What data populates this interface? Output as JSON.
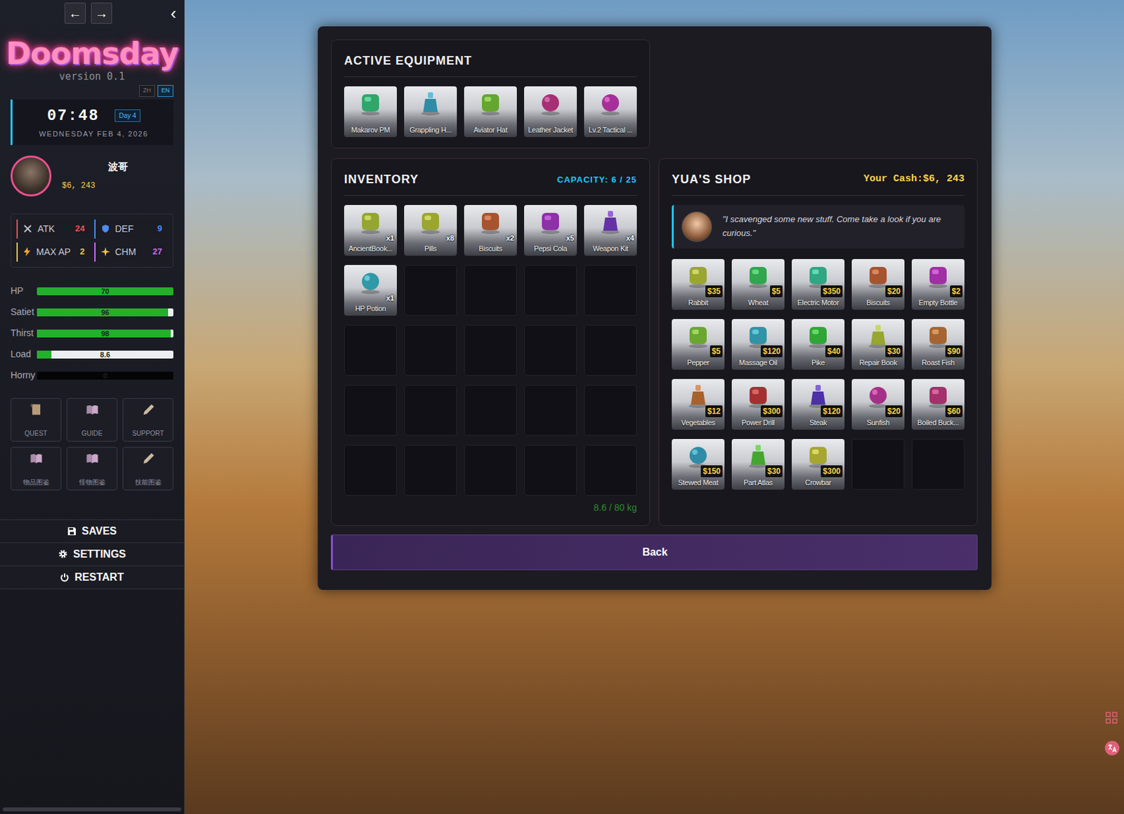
{
  "nav": {
    "back": "←",
    "forward": "→",
    "collapse": "‹"
  },
  "logo": {
    "title": "Doomsday",
    "version": "version 0.1"
  },
  "languages": [
    {
      "label": "ZH",
      "selected": false
    },
    {
      "label": "EN",
      "selected": true
    }
  ],
  "clock": {
    "time": "07:48",
    "day": "Day 4",
    "date": "WEDNESDAY FEB 4, 2026"
  },
  "player": {
    "name": "波哥",
    "cash": "$6, 243"
  },
  "stats": [
    {
      "label": "ATK",
      "value": "24",
      "color": "#ef5350"
    },
    {
      "label": "DEF",
      "value": "9",
      "color": "#4a8cf0"
    },
    {
      "label": "MAX AP",
      "value": "2",
      "color": "#f5c542"
    },
    {
      "label": "CHM",
      "value": "27",
      "color": "#c86cf0"
    }
  ],
  "meters": [
    {
      "label": "HP",
      "reading": "70",
      "level": 1,
      "kind": "light"
    },
    {
      "label": "Satiet",
      "reading": "96",
      "level": 0.96,
      "kind": "light"
    },
    {
      "label": "Thirst",
      "reading": "98",
      "level": 0.98,
      "kind": "light"
    },
    {
      "label": "Load",
      "reading": "8.6",
      "level": 0.1075,
      "kind": "light"
    },
    {
      "label": "Horny",
      "reading": "0",
      "level": 0,
      "kind": "dark"
    }
  ],
  "menu": [
    {
      "label": "QUEST"
    },
    {
      "label": "GUIDE"
    },
    {
      "label": "SUPPORT"
    },
    {
      "label": "物品图鉴"
    },
    {
      "label": "怪物图鉴"
    },
    {
      "label": "技能图鉴"
    }
  ],
  "system": [
    {
      "label": "SAVES"
    },
    {
      "label": "SETTINGS"
    },
    {
      "label": "RESTART"
    }
  ],
  "equipment": {
    "title": "ACTIVE EQUIPMENT",
    "items": [
      {
        "name": "Makarov PM"
      },
      {
        "name": "Grappling H..."
      },
      {
        "name": "Aviator Hat"
      },
      {
        "name": "Leather Jacket"
      },
      {
        "name": "Lv.2 Tactical ..."
      }
    ]
  },
  "inventory": {
    "title": "INVENTORY",
    "capacity": "CAPACITY: 6 / 25",
    "items": [
      {
        "name": "AncientBook...",
        "count": "x1"
      },
      {
        "name": "Pills",
        "count": "x8"
      },
      {
        "name": "Biscuits",
        "count": "x2"
      },
      {
        "name": "Pepsi Cola",
        "count": "x5"
      },
      {
        "name": "Weapon Kit",
        "count": "x4"
      },
      {
        "name": "HP Potion",
        "count": "x1"
      }
    ],
    "empty_slots": 19,
    "weight": "8.6 / 80 kg"
  },
  "shop": {
    "title": "YUA'S SHOP",
    "cash_label": "Your Cash:",
    "cash": "$6, 243",
    "quote": "\"I scavenged some new stuff. Come take a look if you are curious.\"",
    "items": [
      {
        "name": "Rabbit",
        "price": "$35"
      },
      {
        "name": "Wheat",
        "price": "$5"
      },
      {
        "name": "Electric Motor",
        "price": "$350"
      },
      {
        "name": "Biscuits",
        "price": "$20"
      },
      {
        "name": "Empty Bottle",
        "price": "$2"
      },
      {
        "name": "Pepper",
        "price": "$5"
      },
      {
        "name": "Massage Oil",
        "price": "$120"
      },
      {
        "name": "Pike",
        "price": "$40"
      },
      {
        "name": "Repair Book",
        "price": "$30"
      },
      {
        "name": "Roast Fish",
        "price": "$90"
      },
      {
        "name": "Vegetables",
        "price": "$12"
      },
      {
        "name": "Power Drill",
        "price": "$300"
      },
      {
        "name": "Steak",
        "price": "$120"
      },
      {
        "name": "Sunfish",
        "price": "$20"
      },
      {
        "name": "Boiled Buck...",
        "price": "$60"
      },
      {
        "name": "Stewed Meat",
        "price": "$150"
      },
      {
        "name": "Part Atlas",
        "price": "$30"
      },
      {
        "name": "Crowbar",
        "price": "$300"
      }
    ],
    "empty_slots": 2
  },
  "back_button": "Back"
}
